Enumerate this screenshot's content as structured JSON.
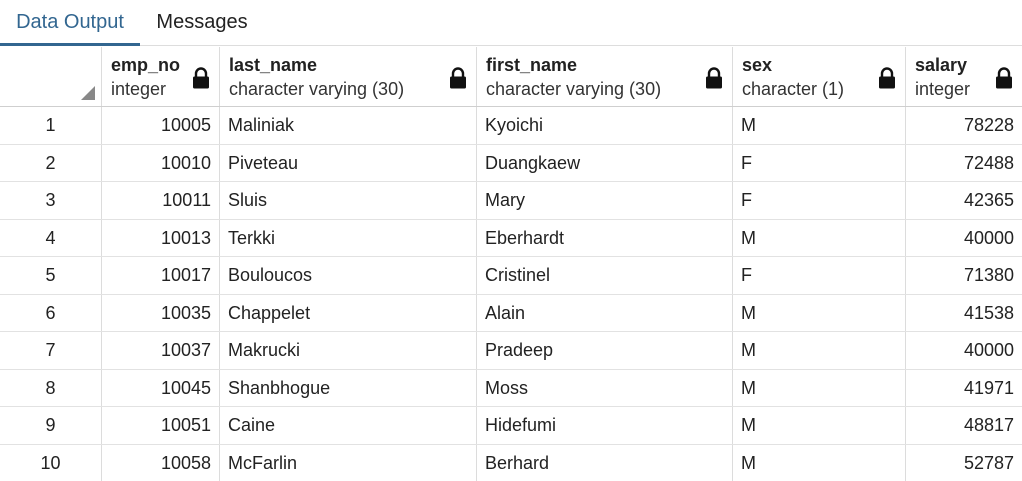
{
  "tabs": [
    {
      "label": "Data Output",
      "active": true
    },
    {
      "label": "Messages",
      "active": false
    }
  ],
  "columns": [
    {
      "name": "emp_no",
      "type": "integer",
      "locked": true
    },
    {
      "name": "last_name",
      "type": "character varying (30)",
      "locked": true
    },
    {
      "name": "first_name",
      "type": "character varying (30)",
      "locked": true
    },
    {
      "name": "sex",
      "type": "character (1)",
      "locked": true
    },
    {
      "name": "salary",
      "type": "integer",
      "locked": true
    }
  ],
  "rows": [
    {
      "n": "1",
      "emp_no": "10005",
      "last_name": "Maliniak",
      "first_name": "Kyoichi",
      "sex": "M",
      "salary": "78228"
    },
    {
      "n": "2",
      "emp_no": "10010",
      "last_name": "Piveteau",
      "first_name": "Duangkaew",
      "sex": "F",
      "salary": "72488"
    },
    {
      "n": "3",
      "emp_no": "10011",
      "last_name": "Sluis",
      "first_name": "Mary",
      "sex": "F",
      "salary": "42365"
    },
    {
      "n": "4",
      "emp_no": "10013",
      "last_name": "Terkki",
      "first_name": "Eberhardt",
      "sex": "M",
      "salary": "40000"
    },
    {
      "n": "5",
      "emp_no": "10017",
      "last_name": "Bouloucos",
      "first_name": "Cristinel",
      "sex": "F",
      "salary": "71380"
    },
    {
      "n": "6",
      "emp_no": "10035",
      "last_name": "Chappelet",
      "first_name": "Alain",
      "sex": "M",
      "salary": "41538"
    },
    {
      "n": "7",
      "emp_no": "10037",
      "last_name": "Makrucki",
      "first_name": "Pradeep",
      "sex": "M",
      "salary": "40000"
    },
    {
      "n": "8",
      "emp_no": "10045",
      "last_name": "Shanbhogue",
      "first_name": "Moss",
      "sex": "M",
      "salary": "41971"
    },
    {
      "n": "9",
      "emp_no": "10051",
      "last_name": "Caine",
      "first_name": "Hidefumi",
      "sex": "M",
      "salary": "48817"
    },
    {
      "n": "10",
      "emp_no": "10058",
      "last_name": "McFarlin",
      "first_name": "Berhard",
      "sex": "M",
      "salary": "52787"
    }
  ],
  "colors": {
    "accent": "#326690",
    "text": "#222222",
    "grid_line": "#dcdcdc"
  },
  "icons": {
    "column_lock": "lock-icon",
    "select_all": "select-all-corner-icon"
  }
}
